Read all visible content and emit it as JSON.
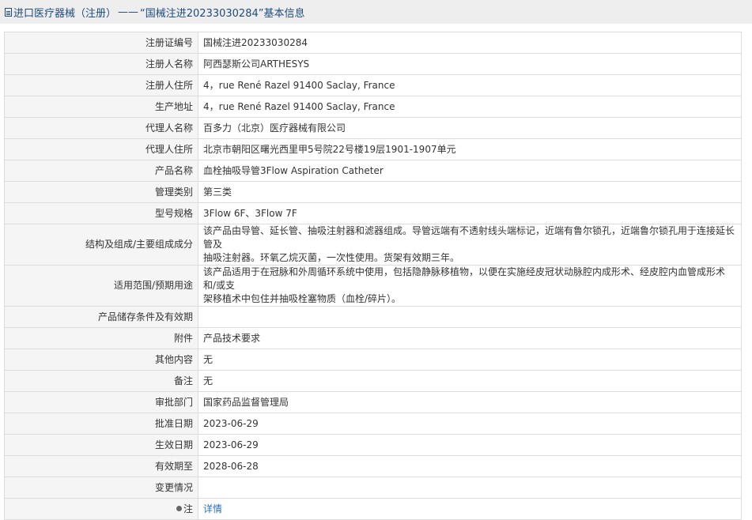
{
  "header": {
    "breadcrumb_link": "进口医疗器械（注册）",
    "separator": "——",
    "page_title": "“国械注进20233030284”基本信息"
  },
  "rows": [
    {
      "label": "注册证编号",
      "value": "国械注进20233030284"
    },
    {
      "label": "注册人名称",
      "value": "阿西瑟斯公司ARTHESYS"
    },
    {
      "label": "注册人住所",
      "value": "4，rue René Razel 91400 Saclay, France"
    },
    {
      "label": "生产地址",
      "value": "4，rue René Razel 91400 Saclay, France"
    },
    {
      "label": "代理人名称",
      "value": "百多力（北京）医疗器械有限公司"
    },
    {
      "label": "代理人住所",
      "value": "北京市朝阳区曙光西里甲5号院22号楼19层1901-1907单元"
    },
    {
      "label": "产品名称",
      "value": "血栓抽吸导管3Flow Aspiration Catheter"
    },
    {
      "label": "管理类别",
      "value": "第三类"
    },
    {
      "label": "型号规格",
      "value": "3Flow 6F、3Flow 7F"
    },
    {
      "label": "结构及组成/主要组成成分",
      "value_line1": "该产品由导管、延长管、抽吸注射器和滤器组成。导管远端有不透射线头端标记，近端有鲁尔锁孔，近端鲁尔锁孔用于连接延长管及",
      "value_line2": "抽吸注射器。环氧乙烷灭菌，一次性使用。货架有效期三年。"
    },
    {
      "label": "适用范围/预期用途",
      "value_line1": "该产品适用于在冠脉和外周循环系统中使用，包括隐静脉移植物，以便在实施经皮冠状动脉腔内成形术、经皮腔内血管成形术和/或支",
      "value_line2": "架移植术中包住并抽吸栓塞物质（血栓/碎片）。"
    },
    {
      "label": "产品储存条件及有效期",
      "value": ""
    },
    {
      "label": "附件",
      "value": "产品技术要求"
    },
    {
      "label": "其他内容",
      "value": "无"
    },
    {
      "label": "备注",
      "value": "无"
    },
    {
      "label": "审批部门",
      "value": "国家药品监督管理局"
    },
    {
      "label": "批准日期",
      "value": "2023-06-29"
    },
    {
      "label": "生效日期",
      "value": "2023-06-29"
    },
    {
      "label": "有效期至",
      "value": "2028-06-28"
    },
    {
      "label": "变更情况",
      "value": ""
    },
    {
      "label": "注",
      "value": "详情",
      "icon": "lightbulb-icon"
    }
  ]
}
